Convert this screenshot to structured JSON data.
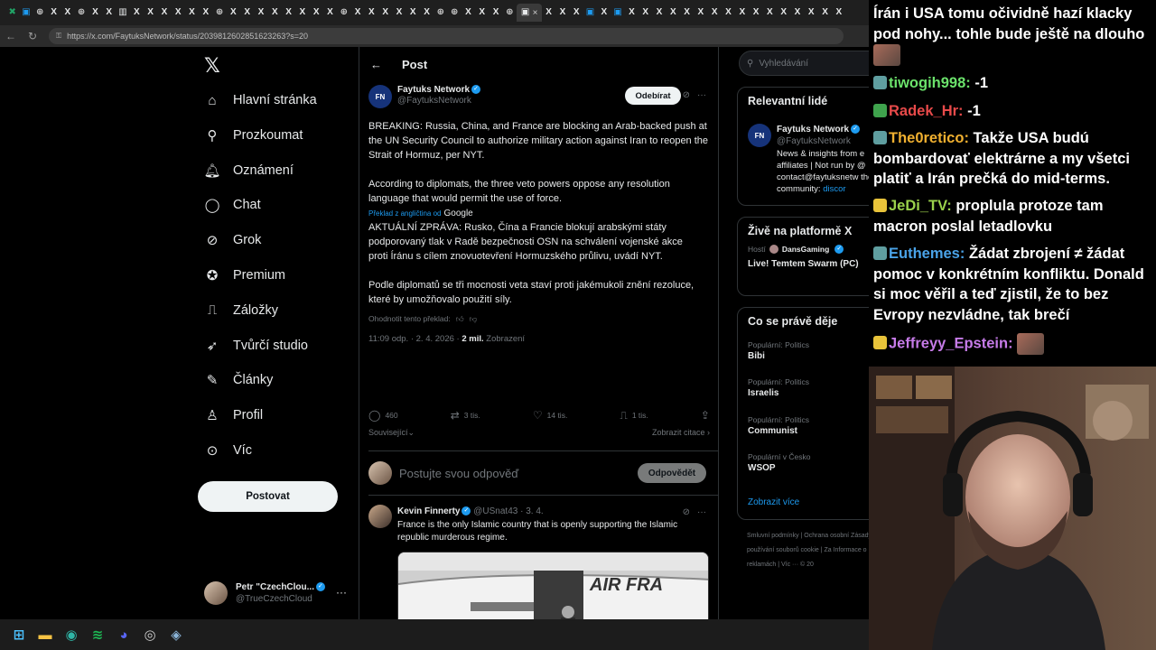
{
  "browser": {
    "tabs": [
      {
        "icon": "spreadsheet-icon",
        "glyph": "✖",
        "color": "#21a366"
      },
      {
        "icon": "x-logo-icon",
        "glyph": "▣",
        "color": "#1d9bf0"
      },
      {
        "icon": "globe-icon",
        "glyph": "⊕",
        "color": "#cfcfcf"
      },
      {
        "icon": "x-logo-icon",
        "glyph": "X",
        "color": "#e7e9ea"
      },
      {
        "icon": "x-logo-icon",
        "glyph": "X",
        "color": "#e7e9ea"
      },
      {
        "icon": "globe-icon",
        "glyph": "⊕",
        "color": "#cfcfcf"
      },
      {
        "icon": "x-logo-icon",
        "glyph": "X",
        "color": "#e7e9ea"
      },
      {
        "icon": "x-logo-icon",
        "glyph": "X",
        "color": "#e7e9ea"
      },
      {
        "icon": "doc-icon",
        "glyph": "▥",
        "color": "#e7e9ea"
      },
      {
        "icon": "x-logo-icon",
        "glyph": "X",
        "color": "#e7e9ea"
      },
      {
        "icon": "x-logo-icon",
        "glyph": "X",
        "color": "#e7e9ea"
      },
      {
        "icon": "x-logo-icon",
        "glyph": "X",
        "color": "#e7e9ea"
      },
      {
        "icon": "x-logo-icon",
        "glyph": "X",
        "color": "#e7e9ea"
      },
      {
        "icon": "x-logo-icon",
        "glyph": "X",
        "color": "#e7e9ea"
      },
      {
        "icon": "x-logo-icon",
        "glyph": "X",
        "color": "#e7e9ea"
      },
      {
        "icon": "globe-icon",
        "glyph": "⊕",
        "color": "#cfcfcf"
      },
      {
        "icon": "x-logo-icon",
        "glyph": "X",
        "color": "#e7e9ea"
      },
      {
        "icon": "x-logo-icon",
        "glyph": "X",
        "color": "#e7e9ea"
      },
      {
        "icon": "x-logo-icon",
        "glyph": "X",
        "color": "#e7e9ea"
      },
      {
        "icon": "x-logo-icon",
        "glyph": "X",
        "color": "#e7e9ea"
      },
      {
        "icon": "x-logo-icon",
        "glyph": "X",
        "color": "#e7e9ea"
      },
      {
        "icon": "x-logo-icon",
        "glyph": "X",
        "color": "#e7e9ea"
      },
      {
        "icon": "x-logo-icon",
        "glyph": "X",
        "color": "#e7e9ea"
      },
      {
        "icon": "x-logo-icon",
        "glyph": "X",
        "color": "#e7e9ea"
      },
      {
        "icon": "globe-icon",
        "glyph": "⊕",
        "color": "#cfcfcf"
      },
      {
        "icon": "x-logo-icon",
        "glyph": "X",
        "color": "#e7e9ea"
      },
      {
        "icon": "x-logo-icon",
        "glyph": "X",
        "color": "#e7e9ea"
      },
      {
        "icon": "x-logo-icon",
        "glyph": "X",
        "color": "#e7e9ea"
      },
      {
        "icon": "x-logo-icon",
        "glyph": "X",
        "color": "#e7e9ea"
      },
      {
        "icon": "x-logo-icon",
        "glyph": "X",
        "color": "#e7e9ea"
      },
      {
        "icon": "x-logo-icon",
        "glyph": "X",
        "color": "#e7e9ea"
      },
      {
        "icon": "globe-icon",
        "glyph": "⊕",
        "color": "#cfcfcf"
      },
      {
        "icon": "globe-icon",
        "glyph": "⊕",
        "color": "#cfcfcf"
      },
      {
        "icon": "x-logo-icon",
        "glyph": "X",
        "color": "#e7e9ea"
      },
      {
        "icon": "x-logo-icon",
        "glyph": "X",
        "color": "#e7e9ea"
      },
      {
        "icon": "x-logo-icon",
        "glyph": "X",
        "color": "#e7e9ea"
      },
      {
        "icon": "globe-icon",
        "glyph": "⊕",
        "color": "#cfcfcf"
      },
      {
        "icon": "active-tab-icon",
        "glyph": "▣",
        "color": "#e7e9ea",
        "active": true
      },
      {
        "icon": "x-logo-icon",
        "glyph": "X",
        "color": "#e7e9ea"
      },
      {
        "icon": "x-logo-icon",
        "glyph": "X",
        "color": "#e7e9ea"
      },
      {
        "icon": "x-logo-icon",
        "glyph": "X",
        "color": "#e7e9ea"
      },
      {
        "icon": "doc-icon",
        "glyph": "▣",
        "color": "#1d9bf0"
      },
      {
        "icon": "x-logo-icon",
        "glyph": "X",
        "color": "#e7e9ea"
      },
      {
        "icon": "doc-icon",
        "glyph": "▣",
        "color": "#1d9bf0"
      },
      {
        "icon": "x-logo-icon",
        "glyph": "X",
        "color": "#e7e9ea"
      },
      {
        "icon": "x-logo-icon",
        "glyph": "X",
        "color": "#e7e9ea"
      },
      {
        "icon": "x-logo-icon",
        "glyph": "X",
        "color": "#e7e9ea"
      },
      {
        "icon": "x-logo-icon",
        "glyph": "X",
        "color": "#e7e9ea"
      },
      {
        "icon": "x-logo-icon",
        "glyph": "X",
        "color": "#e7e9ea"
      },
      {
        "icon": "x-logo-icon",
        "glyph": "X",
        "color": "#e7e9ea"
      },
      {
        "icon": "x-logo-icon",
        "glyph": "X",
        "color": "#e7e9ea"
      },
      {
        "icon": "x-logo-icon",
        "glyph": "X",
        "color": "#e7e9ea"
      },
      {
        "icon": "x-logo-icon",
        "glyph": "X",
        "color": "#e7e9ea"
      },
      {
        "icon": "x-logo-icon",
        "glyph": "X",
        "color": "#e7e9ea"
      },
      {
        "icon": "x-logo-icon",
        "glyph": "X",
        "color": "#e7e9ea"
      },
      {
        "icon": "x-logo-icon",
        "glyph": "X",
        "color": "#e7e9ea"
      },
      {
        "icon": "x-logo-icon",
        "glyph": "X",
        "color": "#e7e9ea"
      },
      {
        "icon": "x-logo-icon",
        "glyph": "X",
        "color": "#e7e9ea"
      },
      {
        "icon": "x-logo-icon",
        "glyph": "X",
        "color": "#e7e9ea"
      },
      {
        "icon": "x-logo-icon",
        "glyph": "X",
        "color": "#e7e9ea"
      }
    ],
    "active_tab_close": "×",
    "url": "https://x.com/FaytuksNetwork/status/2039812602851623263?s=20",
    "nav_back": "←",
    "nav_reload": "↻"
  },
  "x": {
    "logo": "𝕏",
    "nav": [
      {
        "name": "nav-home",
        "icon": "home-icon",
        "glyph": "⌂",
        "label": "Hlavní stránka"
      },
      {
        "name": "nav-explore",
        "icon": "search-icon",
        "glyph": "⚲",
        "label": "Prozkoumat"
      },
      {
        "name": "nav-notifications",
        "icon": "bell-icon",
        "glyph": "🔔︎",
        "label": "Oznámení"
      },
      {
        "name": "nav-chat",
        "icon": "chat-icon",
        "glyph": "◯",
        "label": "Chat"
      },
      {
        "name": "nav-grok",
        "icon": "grok-icon",
        "glyph": "⊘",
        "label": "Grok"
      },
      {
        "name": "nav-premium",
        "icon": "premium-icon",
        "glyph": "✪",
        "label": "Premium"
      },
      {
        "name": "nav-bookmarks",
        "icon": "bookmark-icon",
        "glyph": "⎍",
        "label": "Záložky"
      },
      {
        "name": "nav-creator-studio",
        "icon": "rocket-icon",
        "glyph": "➶",
        "label": "Tvůrčí studio"
      },
      {
        "name": "nav-articles",
        "icon": "articles-icon",
        "glyph": "✎",
        "label": "Články"
      },
      {
        "name": "nav-profile",
        "icon": "person-icon",
        "glyph": "♙",
        "label": "Profil"
      },
      {
        "name": "nav-more",
        "icon": "more-circle-icon",
        "glyph": "⊙",
        "label": "Víc"
      }
    ],
    "post_button": "Postovat",
    "account": {
      "name": "Petr \"CzechClou...",
      "handle": "@TrueCzechCloud",
      "more": "···"
    },
    "header": {
      "back": "←",
      "title": "Post"
    },
    "tweet": {
      "avatar_text": "FN",
      "name": "Faytuks Network",
      "handle": "@FaytuksNetwork",
      "follow": "Odebírat",
      "text": "BREAKING: Russia, China, and France are blocking an Arab-backed push at the UN Security Council to authorize military action against Iran to reopen the Strait of Hormuz, per NYT.\n\nAccording to diplomats, the three veto powers oppose any resolution language that would permit the use of force.",
      "translate_note": "Překlad z angličtina od",
      "translate_brand": "Google",
      "translation": "AKTUÁLNÍ ZPRÁVA: Rusko, Čína a Francie blokují arabskými státy podporovaný tlak v Radě bezpečnosti OSN na schválení vojenské akce proti Íránu s cílem znovuotevření Hormuzského průlivu, uvádí NYT.\n\nPodle diplomatů se tři mocnosti veta staví proti jakémukoli znění rezoluce, které by umožňovalo použití síly.",
      "rate": "Ohodnotit tento překlad:",
      "time": "11:09 odp. · 2. 4. 2026 · ",
      "views": "2 mil.",
      "views_label": " Zobrazení",
      "replies": "460",
      "reposts": "3 tis.",
      "likes": "14 tis.",
      "bookmarks": "1 tis.",
      "related": "Související",
      "quotes": "Zobrazit citace"
    },
    "reply_placeholder": "Postujte svou odpověď",
    "reply_button": "Odpovědět",
    "reply_tweet": {
      "name": "Kevin Finnerty",
      "handle": "@USnat43 · 3. 4.",
      "text": "France is the only Islamic country that is openly supporting the Islamic republic murderous regime.",
      "plane_text": "AIR FRA"
    },
    "right": {
      "search": "Vyhledávání",
      "people_title": "Relevantní lidé",
      "person_name": "Faytuks Network",
      "person_handle": "@FaytuksNetwork",
      "person_bio": "News & insights from e affiliates | Not run by @ contact@faytuksnetw the community: ",
      "person_bio_link": "discor",
      "live_title": "Živě na platformě X",
      "live_host_label": "Hostí",
      "live_host": "DansGaming",
      "live_stream": "Live! Temtem Swarm (PC)",
      "trends_title": "Co se právě děje",
      "trends": [
        {
          "cat": "Populární: Politics",
          "name": "Bibi"
        },
        {
          "cat": "Populární: Politics",
          "name": "Israelis"
        },
        {
          "cat": "Populární: Politics",
          "name": "Communist"
        },
        {
          "cat": "Populární v Česko",
          "name": "WSOP"
        }
      ],
      "show_more": "Zobrazit více",
      "footer": "Smluvní podmínky | Ochrana osobní Zásady používání souborů cookie | Za Informace o reklamách | Víc ··· © 20"
    }
  },
  "taskbar": [
    {
      "icon": "windows-start-icon",
      "glyph": "⊞",
      "color": "#4cc2ff"
    },
    {
      "icon": "file-explorer-icon",
      "glyph": "▬",
      "color": "#f6c344"
    },
    {
      "icon": "edge-icon",
      "glyph": "◉",
      "color": "#2fb5a6"
    },
    {
      "icon": "spotify-icon",
      "glyph": "≋",
      "color": "#1db954"
    },
    {
      "icon": "discord-icon",
      "glyph": "◕",
      "color": "#5865f2"
    },
    {
      "icon": "obs-icon",
      "glyph": "◎",
      "color": "#cccccc"
    },
    {
      "icon": "steam-icon",
      "glyph": "◈",
      "color": "#8ab4d8"
    }
  ],
  "chat": [
    {
      "user": "",
      "text": "Írán i USA tomu očividně hazí klacky pod nohy... tohle bude ještě na dlouho",
      "badge": "",
      "color": "#ffffff"
    },
    {
      "user": "tiwogih998",
      "text": "-1",
      "badge": "#5f9ea0",
      "color": "#6be26b"
    },
    {
      "user": "Radek_Hr",
      "text": "-1",
      "badge": "#3fa34d",
      "color": "#e84a4a"
    },
    {
      "user": "The0retico",
      "text": "Takže USA budú bombardovať elektrárne a my všetci platiť a Irán prečká do mid-terms.",
      "badge": "#5f9ea0",
      "color": "#f0b030"
    },
    {
      "user": "JeDi_TV",
      "text": "proplula protoze tam macron poslal letadlovku",
      "badge": "#e8c33a",
      "color": "#9ad14b"
    },
    {
      "user": "Euthemes",
      "text": "Žádat zbrojení ≠ žádat pomoc v konkrétním konfliktu. Donald si moc věřil a teď zjistil, že to bez Evropy nezvládne, tak brečí",
      "badge": "#5f9ea0",
      "color": "#4aa3e8"
    },
    {
      "user": "Jeffreyy_Epstein",
      "text": "",
      "badge": "#e8c33a",
      "color": "#c67be8"
    }
  ]
}
